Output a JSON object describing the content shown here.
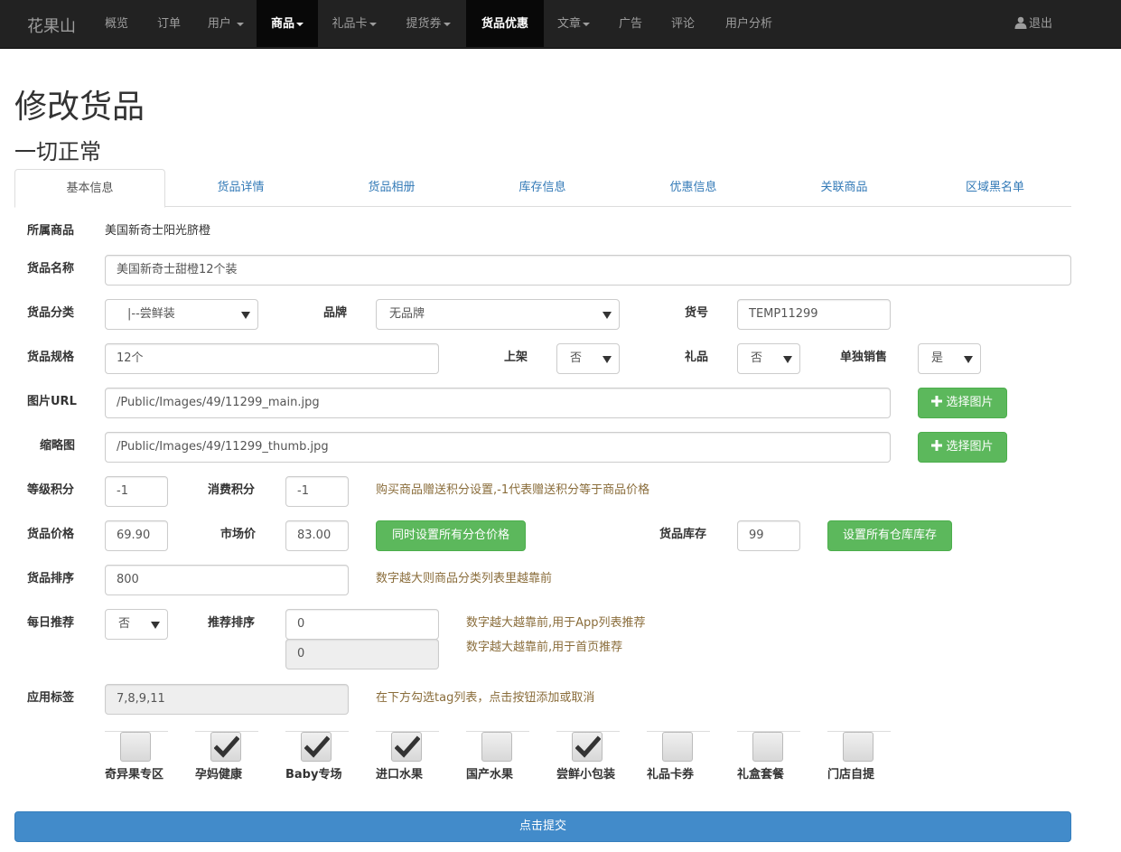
{
  "nav": {
    "brand": "花果山",
    "items": [
      {
        "label": "概览"
      },
      {
        "label": "订单"
      },
      {
        "label": "用户"
      },
      {
        "label": "商品"
      },
      {
        "label": "礼品卡"
      },
      {
        "label": "提货券"
      },
      {
        "label": "货品优惠"
      },
      {
        "label": "文章"
      },
      {
        "label": "广告"
      },
      {
        "label": "评论"
      },
      {
        "label": "用户分析"
      }
    ],
    "logout": "退出"
  },
  "page": {
    "title": "修改货品",
    "subtitle": "一切正常"
  },
  "tabs": [
    "基本信息",
    "货品详情",
    "货品相册",
    "库存信息",
    "优惠信息",
    "关联商品",
    "区域黑名单"
  ],
  "form": {
    "product_label": "所属商品",
    "product_value": "美国新奇士阳光脐橙",
    "name_label": "货品名称",
    "name_value": "美国新奇士甜橙12个装",
    "category_label": "货品分类",
    "category_value": "|--尝鲜装",
    "brand_label": "品牌",
    "brand_value": "无品牌",
    "sku_label": "货号",
    "sku_value": "TEMP11299",
    "spec_label": "货品规格",
    "spec_value": "12个",
    "onsale_label": "上架",
    "onsale_value": "否",
    "gift_label": "礼品",
    "gift_value": "否",
    "solo_label": "单独销售",
    "solo_value": "是",
    "image_label": "图片URL",
    "image_value": "/Public/Images/49/11299_main.jpg",
    "thumb_label": "缩略图",
    "thumb_value": "/Public/Images/49/11299_thumb.jpg",
    "choose_image": "选择图片",
    "level_points_label": "等级积分",
    "level_points_value": "-1",
    "spend_points_label": "消费积分",
    "spend_points_value": "-1",
    "points_help": "购买商品赠送积分设置,-1代表赠送积分等于商品价格",
    "price_label": "货品价格",
    "price_value": "69.90",
    "market_label": "市场价",
    "market_value": "83.00",
    "set_price_btn": "同时设置所有分仓价格",
    "stock_label": "货品库存",
    "stock_value": "99",
    "set_stock_btn": "设置所有仓库库存",
    "sort_label": "货品排序",
    "sort_value": "800",
    "sort_help": "数字越大则商品分类列表里越靠前",
    "daily_label": "每日推荐",
    "daily_value": "否",
    "rec_sort_label": "推荐排序",
    "rec_sort_value": "0",
    "rec_sort_help": "数字越大越靠前,用于App列表推荐",
    "home_sort_value": "0",
    "home_sort_help": "数字越大越靠前,用于首页推荐",
    "tags_label": "应用标签",
    "tags_value": "7,8,9,11",
    "tags_help": "在下方勾选tag列表，点击按钮添加或取消"
  },
  "tags": [
    {
      "label": "奇异果专区",
      "checked": false
    },
    {
      "label": "孕妈健康",
      "checked": true
    },
    {
      "label": "Baby专场",
      "checked": true
    },
    {
      "label": "进口水果",
      "checked": true
    },
    {
      "label": "国产水果",
      "checked": false
    },
    {
      "label": "尝鲜小包装",
      "checked": true
    },
    {
      "label": "礼品卡券",
      "checked": false
    },
    {
      "label": "礼盒套餐",
      "checked": false
    },
    {
      "label": "门店自提",
      "checked": false
    }
  ],
  "submit": "点击提交"
}
